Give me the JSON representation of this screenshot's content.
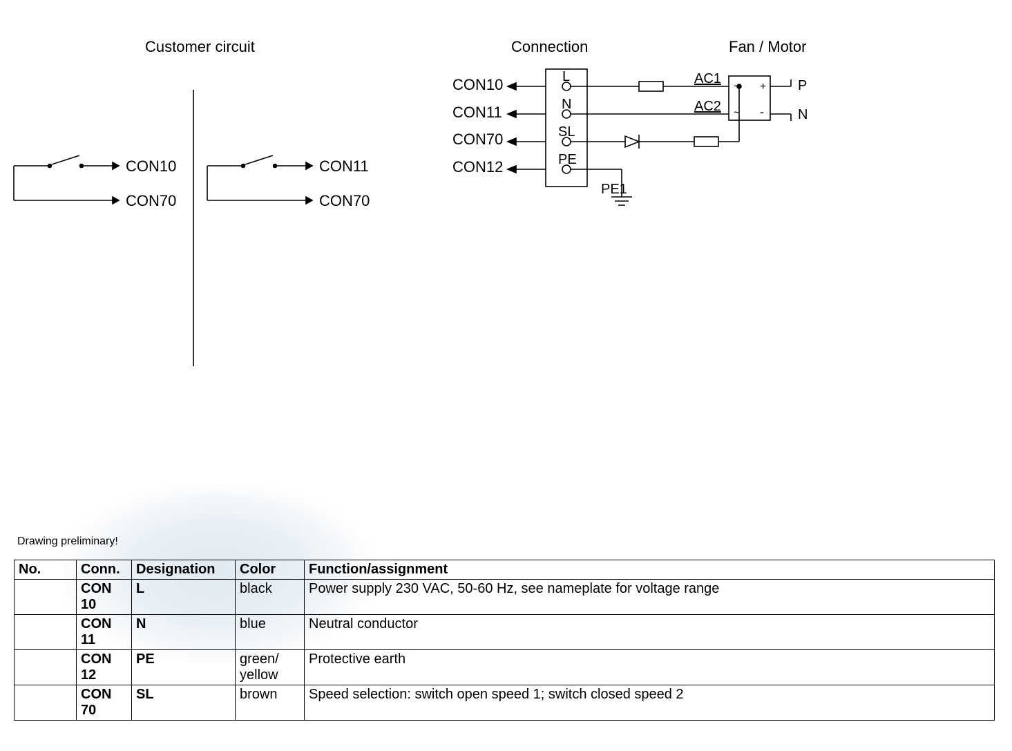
{
  "sections": {
    "left": "Customer circuit",
    "mid": "Connection",
    "right": "Fan / Motor"
  },
  "schematic": {
    "left_block": {
      "upper_arrow": "CON10",
      "lower_arrow": "CON70"
    },
    "mid_block": {
      "upper_arrow": "CON11",
      "lower_arrow": "CON70"
    },
    "right_block": {
      "rows": [
        {
          "con": "CON10",
          "terminal": "L"
        },
        {
          "con": "CON11",
          "terminal": "N"
        },
        {
          "con": "CON70",
          "terminal": "SL"
        },
        {
          "con": "CON12",
          "terminal": "PE"
        }
      ],
      "pe_ground": "PE1",
      "ac_top": "AC1",
      "ac_bot": "AC2",
      "motor_p": "P",
      "motor_n": "N",
      "tilde": "~",
      "plus": "+",
      "minus": "-"
    }
  },
  "note": "Drawing preliminary!",
  "table": {
    "headers": {
      "no": "No.",
      "conn": "Conn.",
      "desig": "Designation",
      "color": "Color",
      "func": "Function/assignment"
    },
    "rows": [
      {
        "no": "",
        "conn": "CON 10",
        "desig": "L",
        "color": "black",
        "func": "Power supply 230 VAC, 50-60 Hz, see nameplate for voltage range"
      },
      {
        "no": "",
        "conn": "CON 11",
        "desig": "N",
        "color": "blue",
        "func": "Neutral conductor"
      },
      {
        "no": "",
        "conn": "CON 12",
        "desig": "PE",
        "color": "green/ yellow",
        "func": "Protective earth"
      },
      {
        "no": "",
        "conn": "CON 70",
        "desig": "SL",
        "color": "brown",
        "func": "Speed selection: switch open speed 1; switch closed speed 2"
      }
    ]
  }
}
